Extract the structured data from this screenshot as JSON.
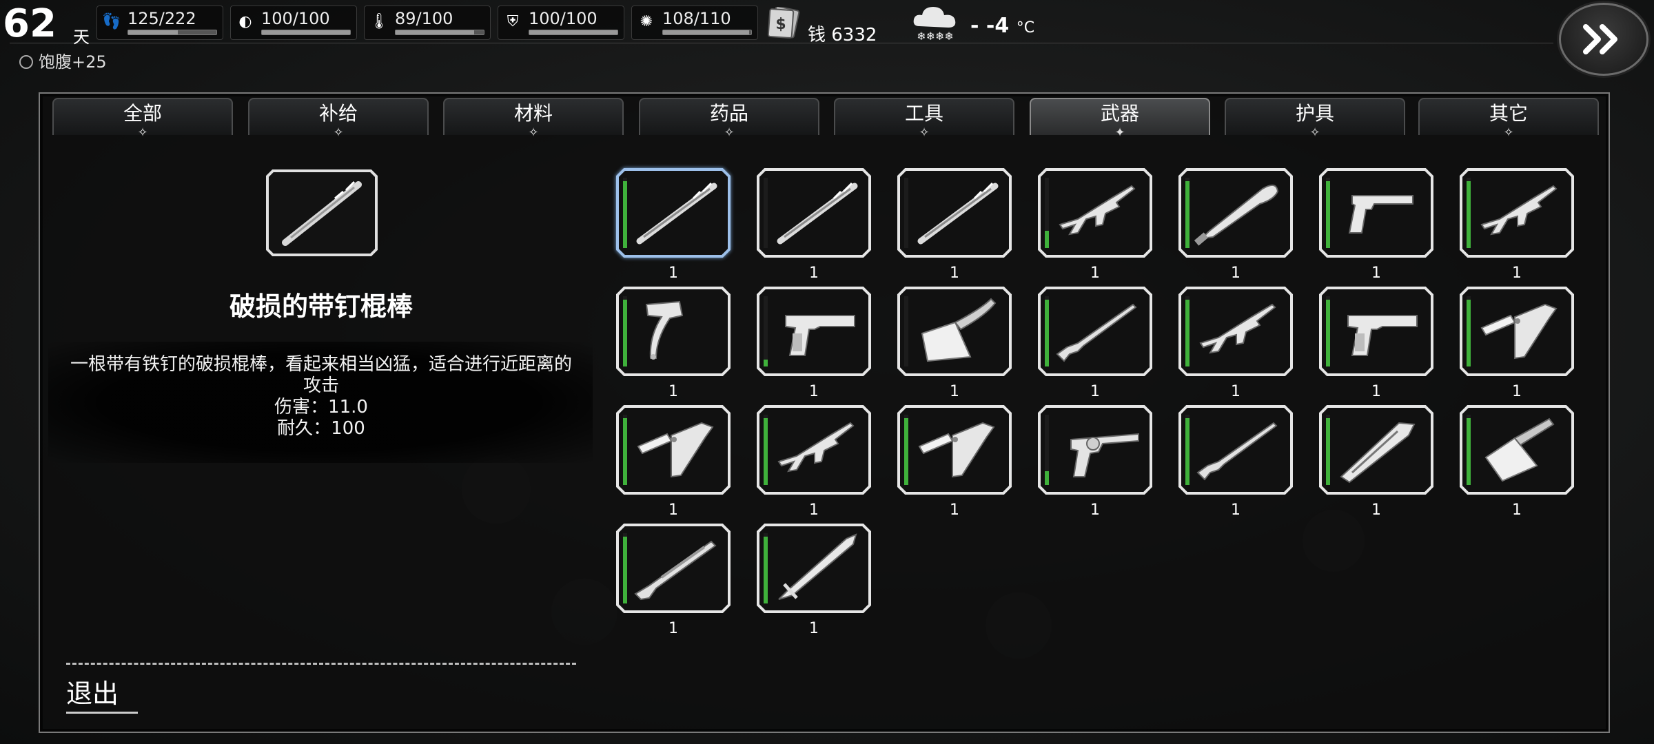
{
  "hud": {
    "day_number": "62",
    "day_unit": "天",
    "stats": [
      {
        "icon": "footprints-icon",
        "value": "125/222",
        "level": 0.56
      },
      {
        "icon": "stomach-icon",
        "value": "100/100",
        "level": 1.0
      },
      {
        "icon": "thermometer-icon",
        "value": "89/100",
        "level": 0.89
      },
      {
        "icon": "health-shield-icon",
        "value": "100/100",
        "level": 1.0
      },
      {
        "icon": "brain-icon",
        "value": "108/110",
        "level": 0.98
      }
    ],
    "money_label": "钱 6332",
    "weather_icon": "snow-cloud-icon",
    "temperature": "- -4",
    "temperature_unit": "°C",
    "status_effect": "饱腹+25"
  },
  "tabs": [
    {
      "label": "全部",
      "active": false
    },
    {
      "label": "补给",
      "active": false
    },
    {
      "label": "材料",
      "active": false
    },
    {
      "label": "药品",
      "active": false
    },
    {
      "label": "工具",
      "active": false
    },
    {
      "label": "武器",
      "active": true
    },
    {
      "label": "护具",
      "active": false
    },
    {
      "label": "其它",
      "active": false
    }
  ],
  "detail": {
    "name": "破损的带钉棍棒",
    "description": "一根带有铁钉的破损棍棒，看起来相当凶猛，适合进行近距离的攻击",
    "damage": "伤害：11.0",
    "durability": "耐久：100"
  },
  "exit_label": "退出",
  "inventory": [
    {
      "icon": "spiked-club-icon",
      "qty": "1",
      "durability": 0.95,
      "selected": true
    },
    {
      "icon": "spiked-club-icon",
      "qty": "1",
      "durability": 0.0
    },
    {
      "icon": "spiked-club-icon",
      "qty": "1",
      "durability": 0.0
    },
    {
      "icon": "assault-rifle-icon",
      "qty": "1",
      "durability": 0.25
    },
    {
      "icon": "machete-icon",
      "qty": "1",
      "durability": 0.95
    },
    {
      "icon": "luger-pistol-icon",
      "qty": "1",
      "durability": 0.95
    },
    {
      "icon": "assault-rifle-icon",
      "qty": "1",
      "durability": 0.95
    },
    {
      "icon": "hatchet-icon",
      "qty": "1",
      "durability": 0.95
    },
    {
      "icon": "pistol-icon",
      "qty": "1",
      "durability": 0.1
    },
    {
      "icon": "cleaver-icon",
      "qty": "1",
      "durability": 0.0
    },
    {
      "icon": "rifle-icon",
      "qty": "1",
      "durability": 0.95
    },
    {
      "icon": "assault-rifle-icon",
      "qty": "1",
      "durability": 0.95
    },
    {
      "icon": "pistol-icon",
      "qty": "1",
      "durability": 0.95
    },
    {
      "icon": "folding-knife-icon",
      "qty": "1",
      "durability": 0.95
    },
    {
      "icon": "folding-knife-icon",
      "qty": "1",
      "durability": 0.95
    },
    {
      "icon": "assault-rifle-icon",
      "qty": "1",
      "durability": 0.95
    },
    {
      "icon": "folding-knife-icon",
      "qty": "1",
      "durability": 0.95
    },
    {
      "icon": "revolver-icon",
      "qty": "1",
      "durability": 0.2
    },
    {
      "icon": "rifle-icon",
      "qty": "1",
      "durability": 0.95
    },
    {
      "icon": "utility-knife-icon",
      "qty": "1",
      "durability": 0.95
    },
    {
      "icon": "meat-cleaver-icon",
      "qty": "1",
      "durability": 0.95
    },
    {
      "icon": "shotgun-icon",
      "qty": "1",
      "durability": 0.95
    },
    {
      "icon": "long-sword-icon",
      "qty": "1",
      "durability": 0.95
    }
  ]
}
